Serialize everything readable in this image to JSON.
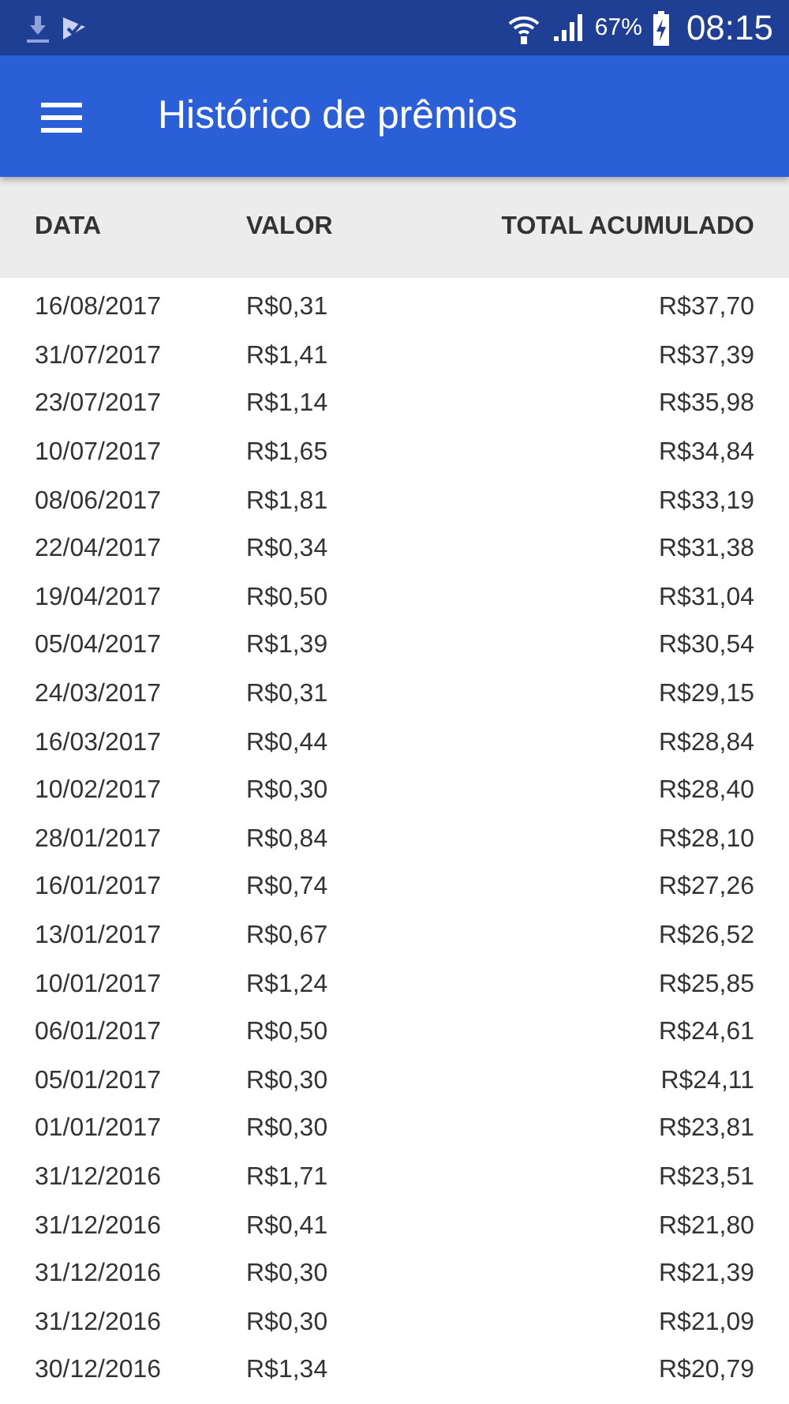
{
  "status_bar": {
    "battery": "67%",
    "time": "08:15"
  },
  "app_bar": {
    "title": "Histórico de prêmios"
  },
  "table": {
    "columns": [
      "DATA",
      "VALOR",
      "TOTAL ACUMULADO"
    ],
    "rows": [
      [
        "16/08/2017",
        "R$0,31",
        "R$37,70"
      ],
      [
        "31/07/2017",
        "R$1,41",
        "R$37,39"
      ],
      [
        "23/07/2017",
        "R$1,14",
        "R$35,98"
      ],
      [
        "10/07/2017",
        "R$1,65",
        "R$34,84"
      ],
      [
        "08/06/2017",
        "R$1,81",
        "R$33,19"
      ],
      [
        "22/04/2017",
        "R$0,34",
        "R$31,38"
      ],
      [
        "19/04/2017",
        "R$0,50",
        "R$31,04"
      ],
      [
        "05/04/2017",
        "R$1,39",
        "R$30,54"
      ],
      [
        "24/03/2017",
        "R$0,31",
        "R$29,15"
      ],
      [
        "16/03/2017",
        "R$0,44",
        "R$28,84"
      ],
      [
        "10/02/2017",
        "R$0,30",
        "R$28,40"
      ],
      [
        "28/01/2017",
        "R$0,84",
        "R$28,10"
      ],
      [
        "16/01/2017",
        "R$0,74",
        "R$27,26"
      ],
      [
        "13/01/2017",
        "R$0,67",
        "R$26,52"
      ],
      [
        "10/01/2017",
        "R$1,24",
        "R$25,85"
      ],
      [
        "06/01/2017",
        "R$0,50",
        "R$24,61"
      ],
      [
        "05/01/2017",
        "R$0,30",
        "R$24,11"
      ],
      [
        "01/01/2017",
        "R$0,30",
        "R$23,81"
      ],
      [
        "31/12/2016",
        "R$1,71",
        "R$23,51"
      ],
      [
        "31/12/2016",
        "R$0,41",
        "R$21,80"
      ],
      [
        "31/12/2016",
        "R$0,30",
        "R$21,39"
      ],
      [
        "31/12/2016",
        "R$0,30",
        "R$21,09"
      ],
      [
        "30/12/2016",
        "R$1,34",
        "R$20,79"
      ]
    ]
  }
}
